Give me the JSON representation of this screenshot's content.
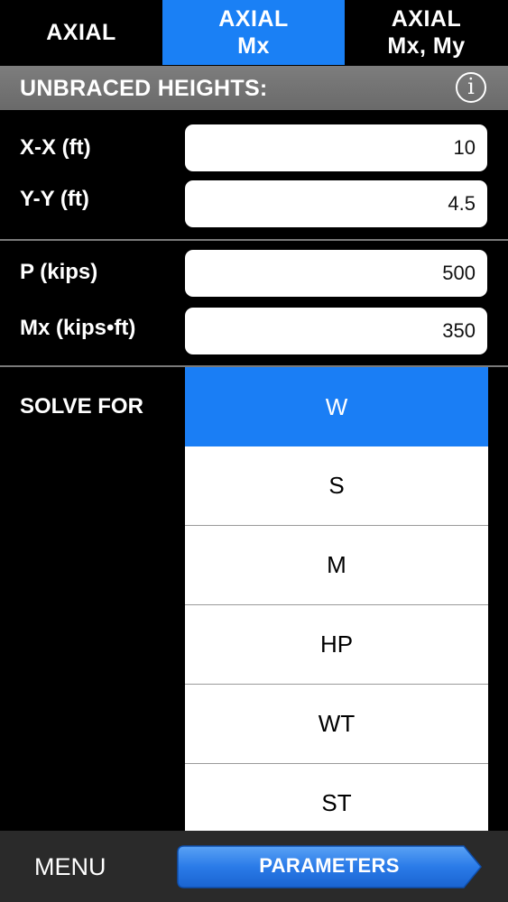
{
  "tabs": [
    {
      "line1": "AXIAL",
      "line2": ""
    },
    {
      "line1": "AXIAL",
      "line2": "Mx"
    },
    {
      "line1": "AXIAL",
      "line2": "Mx, My"
    }
  ],
  "selected_tab": 1,
  "section": {
    "title": "UNBRACED HEIGHTS:",
    "info_icon": "info-icon"
  },
  "fields": {
    "xx": {
      "label": "X-X (ft)",
      "value": "10"
    },
    "yy": {
      "label": "Y-Y (ft)",
      "value": "4.5"
    },
    "p": {
      "label": "P (kips)",
      "value": "500"
    },
    "mx": {
      "label": "Mx (kips•ft)",
      "value": "350"
    }
  },
  "solve_for": {
    "label": "SOLVE FOR",
    "options": [
      "W",
      "S",
      "M",
      "HP",
      "WT",
      "ST"
    ],
    "selected": "W"
  },
  "bottom_bar": {
    "menu_label": "MENU",
    "parameters_label": "PARAMETERS"
  },
  "colors": {
    "accent": "#1a80f5",
    "header": "#737373",
    "background": "#000000"
  }
}
